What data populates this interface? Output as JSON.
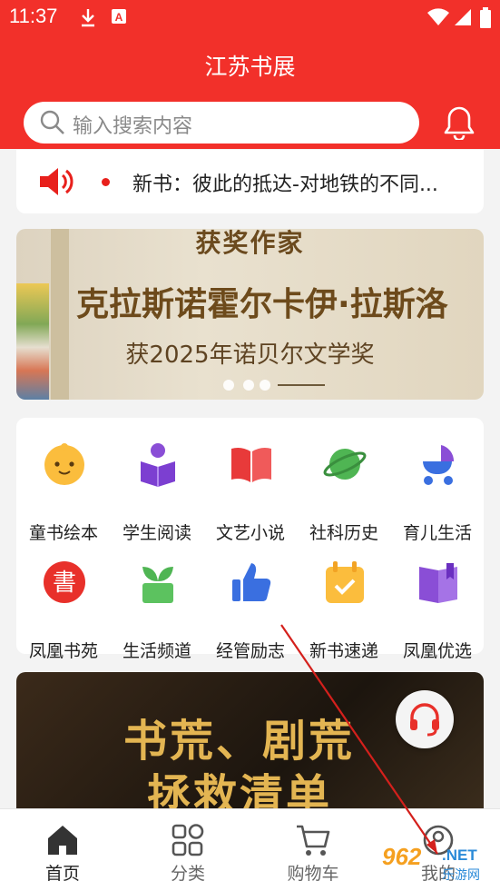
{
  "status_bar": {
    "time": "11:37",
    "icons": [
      "download-icon",
      "a-badge-icon",
      "wifi-icon",
      "signal-icon",
      "battery-icon"
    ]
  },
  "header": {
    "title": "江苏书展",
    "bg_color": "#f2302a"
  },
  "search": {
    "placeholder": "输入搜索内容"
  },
  "notice": {
    "text": "新书：彼此的抵达-对地铁的不同..."
  },
  "banner": {
    "top_text": "获奖作家",
    "main_text": "克拉斯诺霍尔卡伊·拉斯洛",
    "sub_text": "获2025年诺贝尔文学奖"
  },
  "categories": [
    {
      "label": "童书绘本",
      "icon": "baby-face-icon"
    },
    {
      "label": "学生阅读",
      "icon": "student-reading-icon"
    },
    {
      "label": "文艺小说",
      "icon": "open-book-icon"
    },
    {
      "label": "社科历史",
      "icon": "planet-icon"
    },
    {
      "label": "育儿生活",
      "icon": "stroller-icon"
    },
    {
      "label": "凤凰书苑",
      "icon": "shu-seal-icon"
    },
    {
      "label": "生活频道",
      "icon": "sprout-pot-icon"
    },
    {
      "label": "经管励志",
      "icon": "thumbs-up-icon"
    },
    {
      "label": "新书速递",
      "icon": "calendar-check-icon"
    },
    {
      "label": "凤凰优选",
      "icon": "bookmark-book-icon"
    }
  ],
  "promo": {
    "line1": "书荒、剧荒",
    "line2": "拯救清单"
  },
  "tabs": [
    {
      "label": "首页",
      "icon": "home-icon",
      "active": true
    },
    {
      "label": "分类",
      "icon": "grid-icon",
      "active": false
    },
    {
      "label": "购物车",
      "icon": "cart-icon",
      "active": false
    },
    {
      "label": "我的",
      "icon": "profile-icon",
      "active": false
    }
  ],
  "watermark": {
    "brand": "962",
    "domain": ".NET",
    "text": "乐游网"
  }
}
